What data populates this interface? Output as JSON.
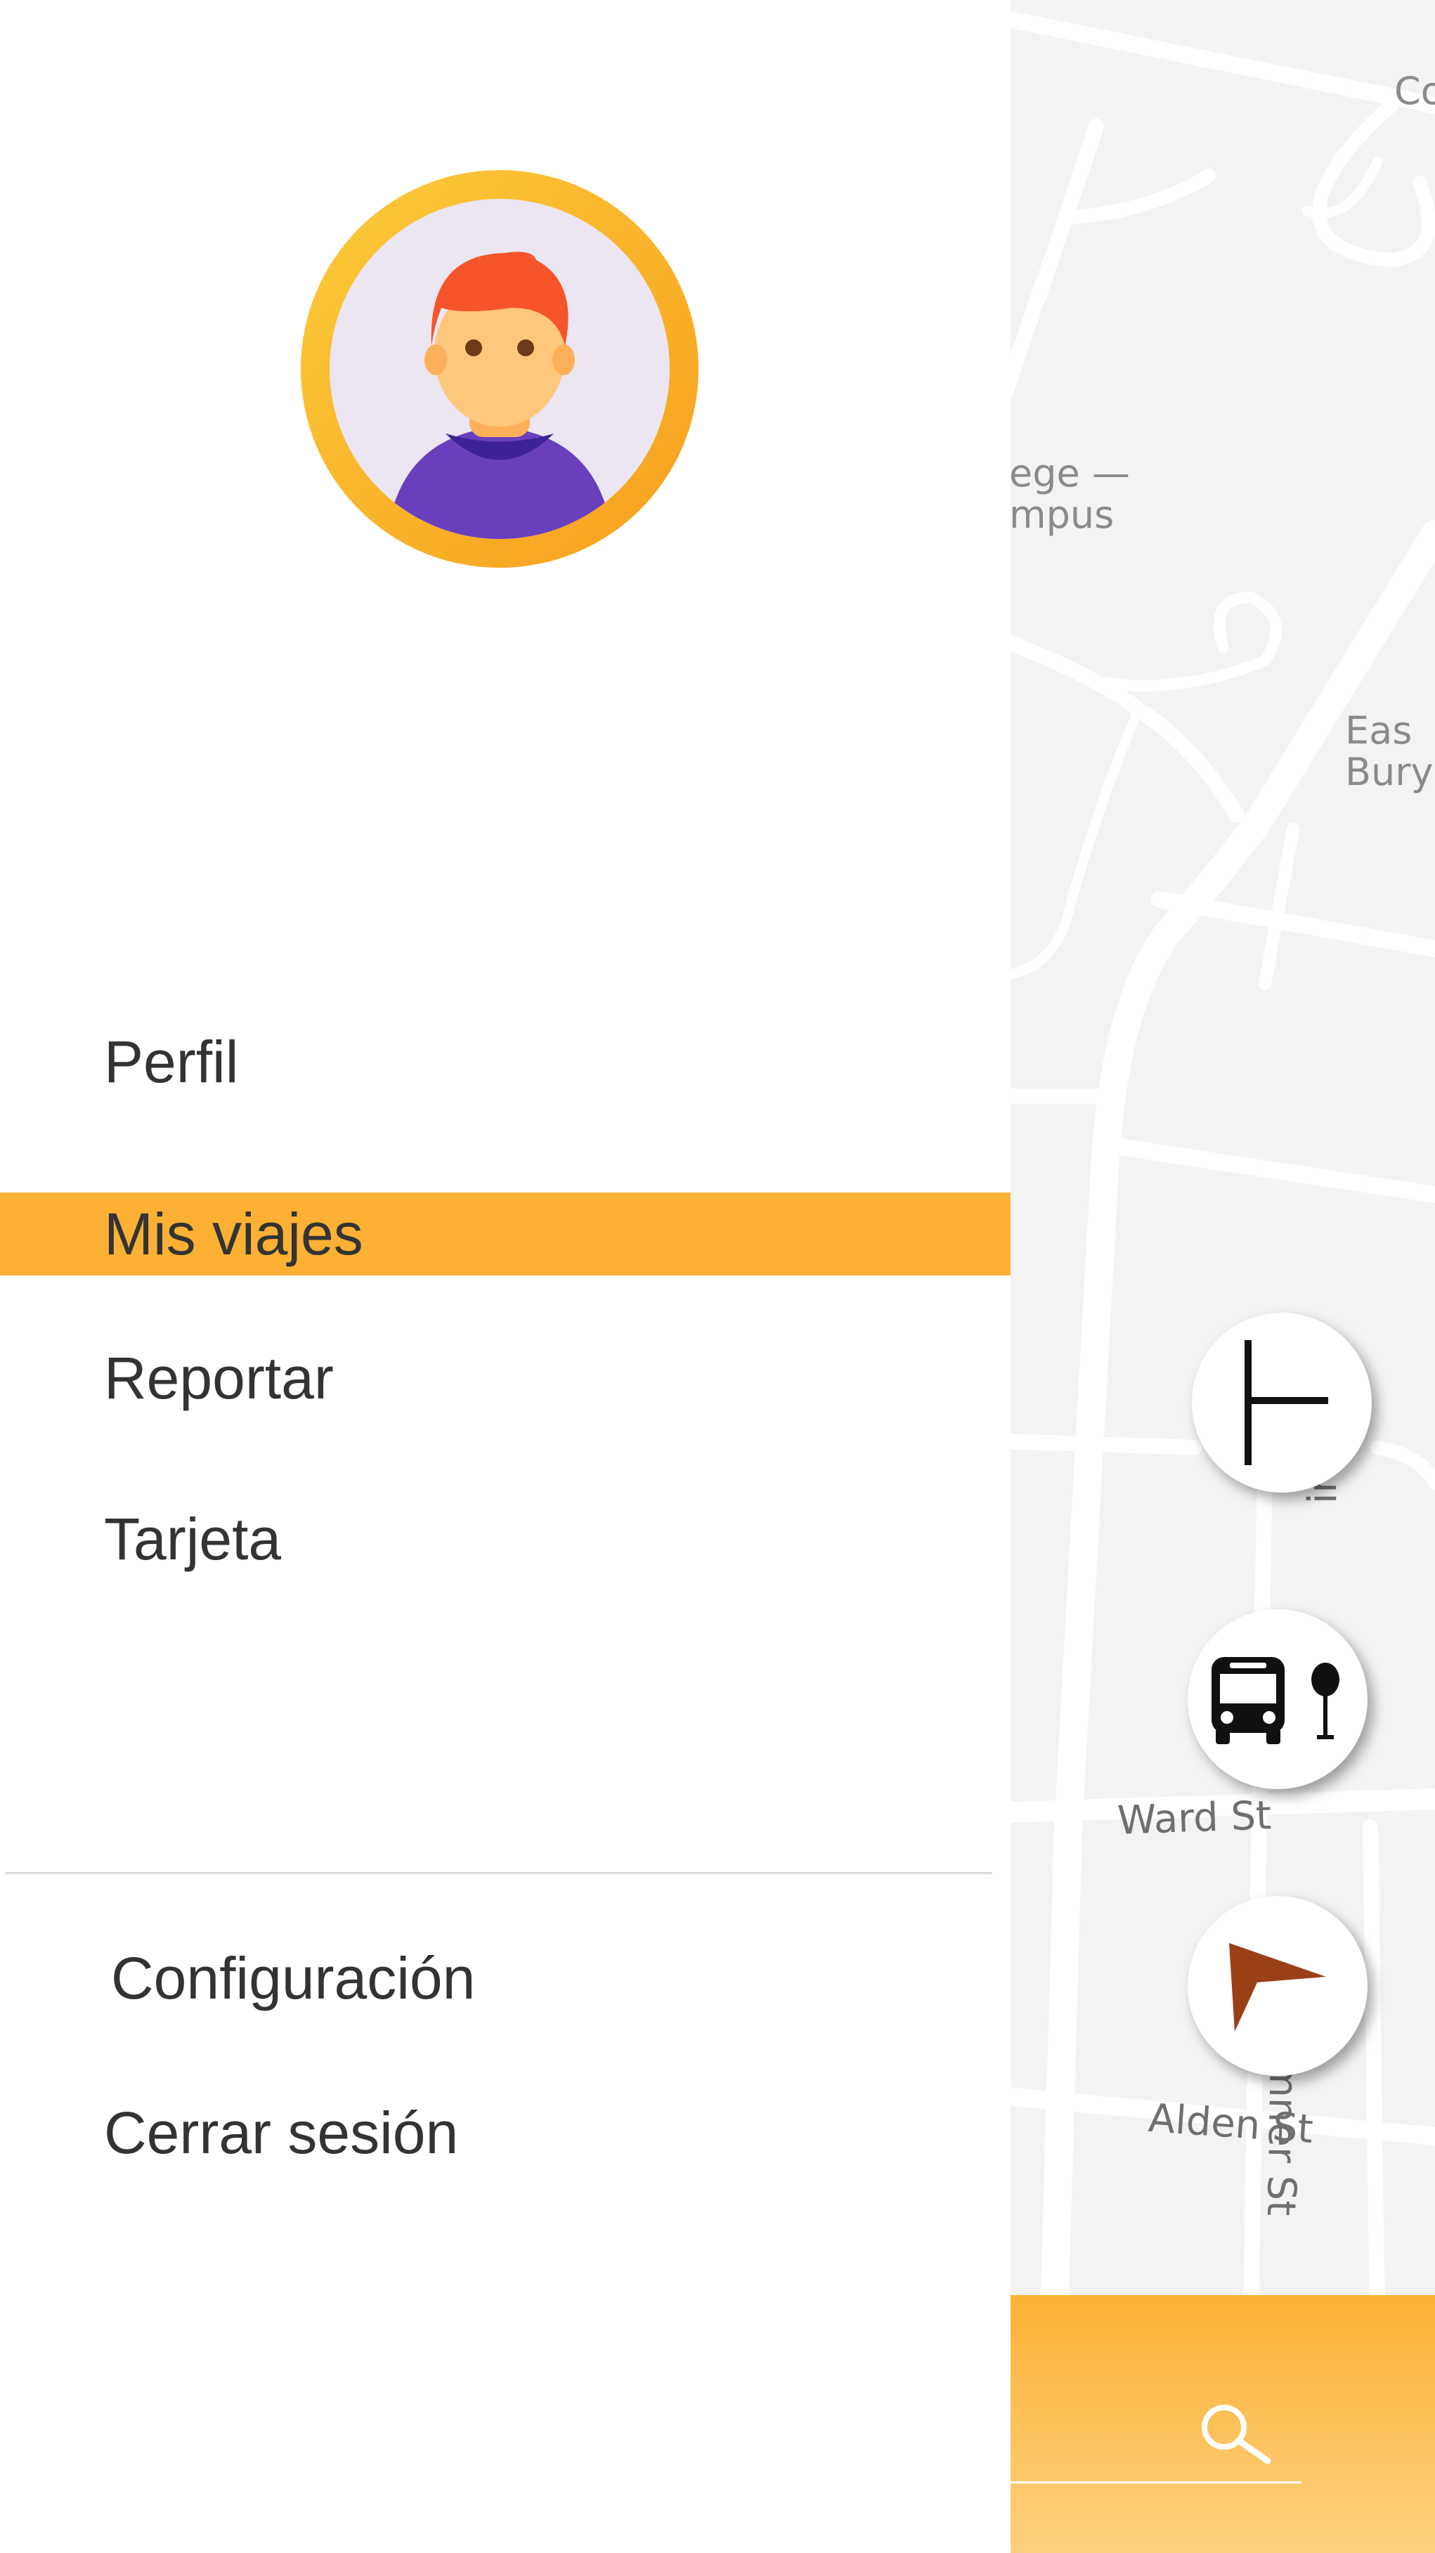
{
  "drawer": {
    "menu": [
      {
        "label": "Perfil"
      },
      {
        "label": "Mis viajes",
        "active": true
      },
      {
        "label": "Reportar"
      },
      {
        "label": "Tarjeta"
      }
    ],
    "footer": [
      {
        "label": "Configuración"
      },
      {
        "label": "Cerrar sesión"
      }
    ]
  },
  "map": {
    "labels": {
      "top_right": "Co",
      "campus": "ege —\nmpus",
      "burying": "Eas\nBuryi",
      "ward_st": "Ward St",
      "alden_st": "Alden St",
      "sumner_st": "Sumner St",
      "ing_st": "ing St"
    }
  },
  "map_buttons": [
    {
      "name": "routes",
      "icon": "route-branch-icon"
    },
    {
      "name": "bus-stop",
      "icon": "bus-stop-icon"
    },
    {
      "name": "navigate",
      "icon": "navigation-arrow-icon"
    }
  ],
  "search_bar": {
    "icon": "search-icon"
  },
  "colors": {
    "accent": "#fcb034",
    "drawer_bg": "#ffffff",
    "text": "#333333",
    "map_bg": "#f3f3f3",
    "navigate_arrow": "#9a4016"
  }
}
